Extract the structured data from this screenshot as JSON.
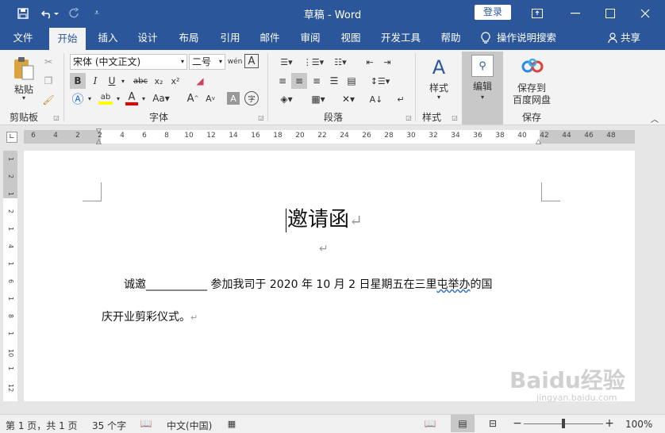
{
  "title_bar": {
    "doc_title": "草稿",
    "sep": "-",
    "app_name": "Word",
    "login": "登录"
  },
  "tabs": [
    "文件",
    "开始",
    "插入",
    "设计",
    "布局",
    "引用",
    "邮件",
    "审阅",
    "视图",
    "开发工具",
    "帮助"
  ],
  "tell_me": "操作说明搜索",
  "share": "共享",
  "ribbon": {
    "paste": "粘贴",
    "clipboard": "剪贴板",
    "font_name": "宋体 (中文正文)",
    "font_size": "二号",
    "font_group": "字体",
    "paragraph_group": "段落",
    "styles": "样式",
    "styles_group": "样式",
    "edit": "编辑",
    "save_to": "保存到",
    "baidu_disk": "百度网盘",
    "save_group": "保存"
  },
  "ruler_h": [
    "6",
    "4",
    "2",
    "2",
    "4",
    "6",
    "8",
    "10",
    "12",
    "14",
    "16",
    "18",
    "20",
    "22",
    "24",
    "26",
    "28",
    "30",
    "32",
    "34",
    "36",
    "38",
    "40",
    "42",
    "44",
    "46",
    "48"
  ],
  "ruler_v": [
    "1",
    "2",
    "1",
    "2",
    "1",
    "4",
    "1",
    "6",
    "1",
    "8",
    "1",
    "10",
    "1",
    "12"
  ],
  "document": {
    "heading": "邀请函",
    "para_line1_a": "诚邀",
    "para_blank": "___________",
    "para_line1_b": " 参加我司于 2020 年 10 月 2 日星期五在三里",
    "para_squiggle": "屯举办",
    "para_line1_c": "的国",
    "para_line2": "庆开业剪彩仪式。",
    "pilcrow": "↵"
  },
  "status": {
    "page": "第 1 页，共 1 页",
    "words": "35 个字",
    "language": "中文(中国)",
    "zoom": "100%"
  },
  "watermark": {
    "brand": "Baidu经验",
    "url": "jingyan.baidu.com"
  },
  "colors": {
    "brand": "#2b579a",
    "highlight": "#ffff00",
    "font_color": "#e00000"
  }
}
